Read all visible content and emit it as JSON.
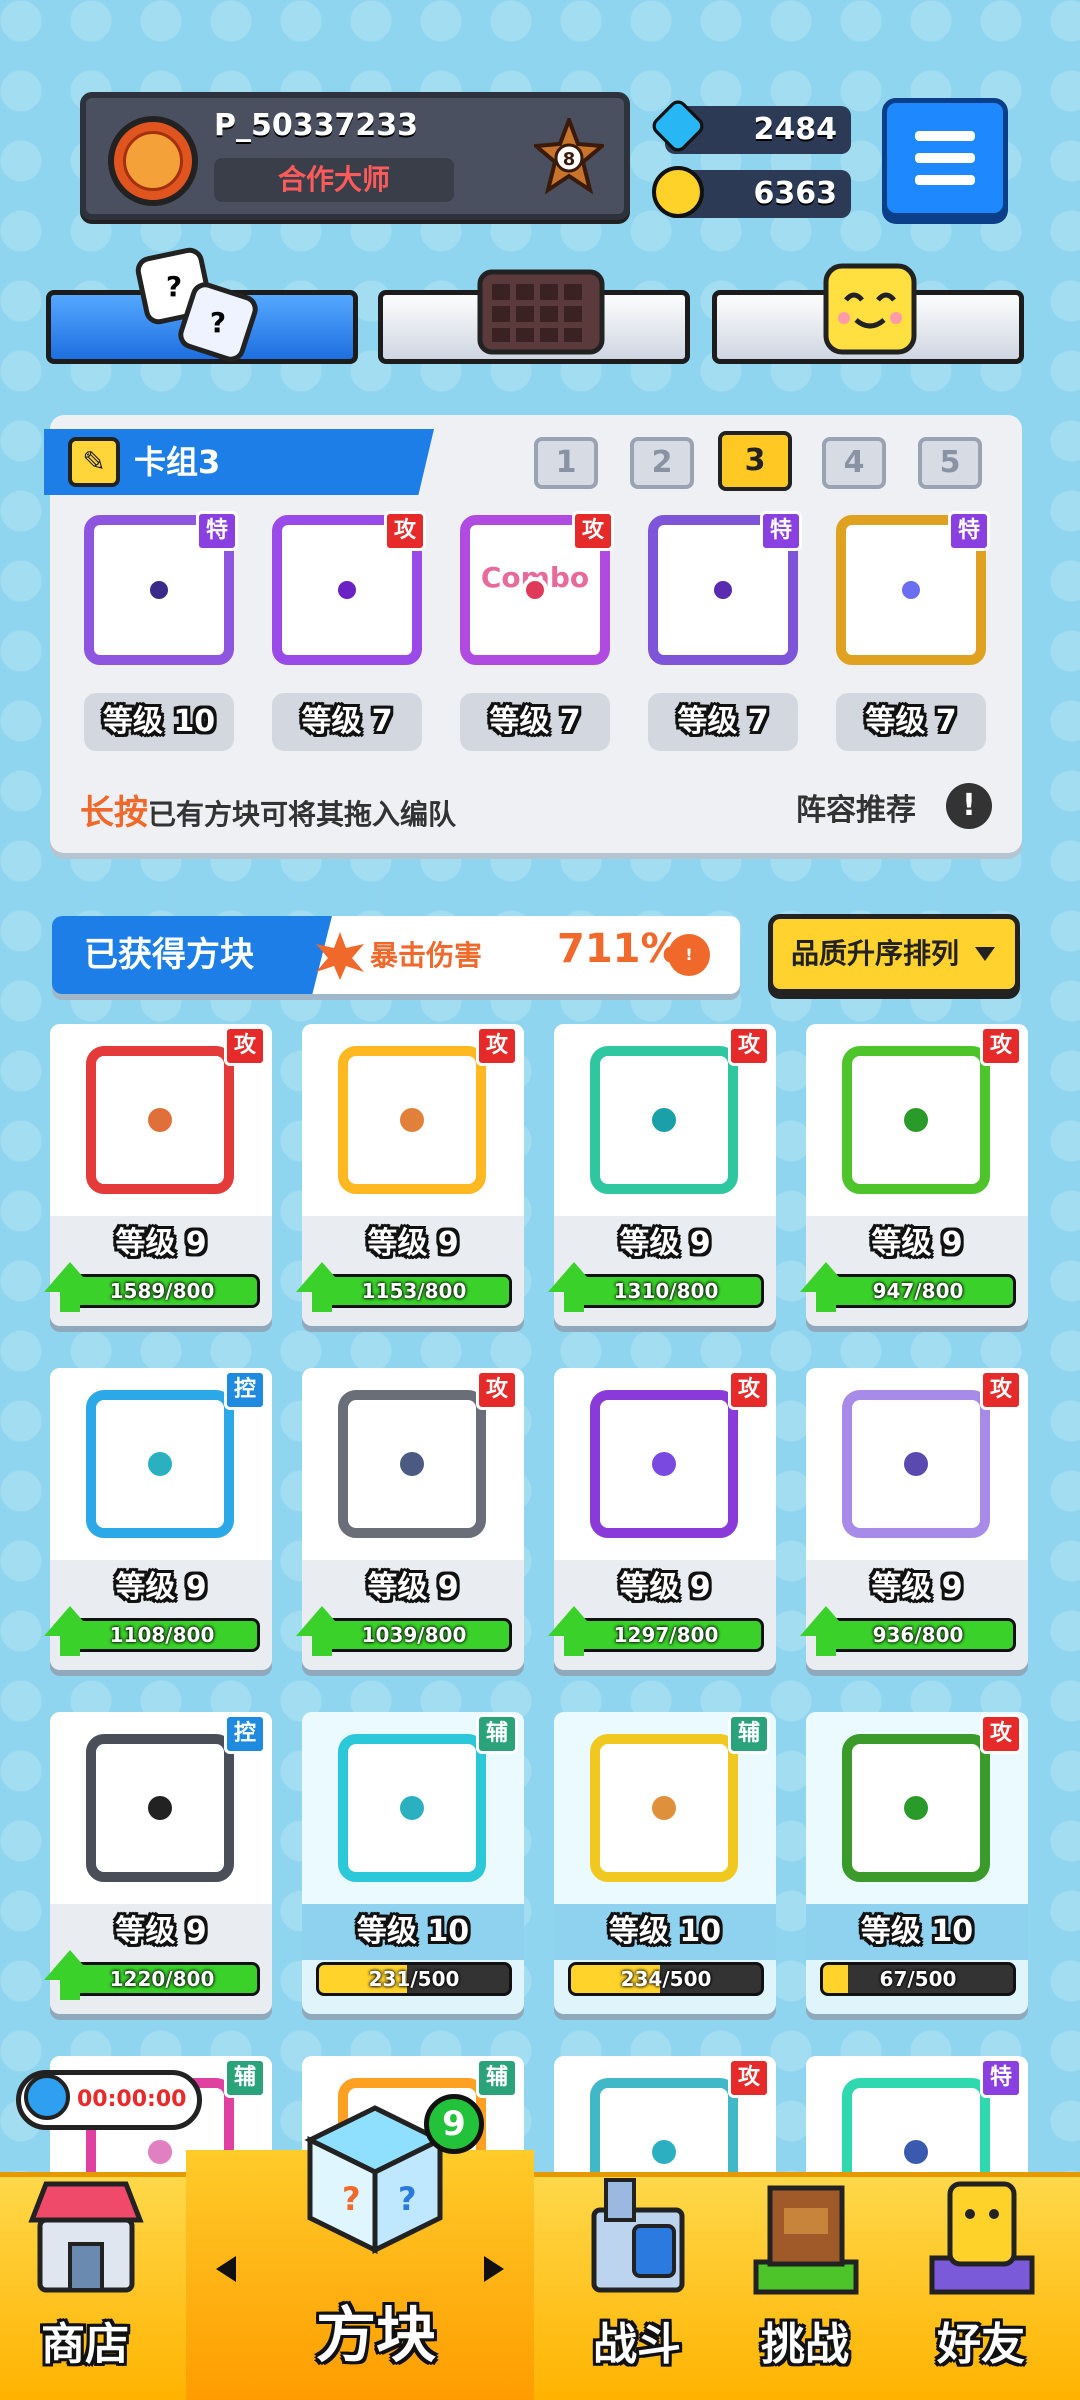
{
  "header": {
    "player_name": "P_50337233",
    "player_title": "合作大师",
    "rank_number": "8",
    "gems": "2484",
    "coins": "6363"
  },
  "colors": {
    "attack": "#e62a2a",
    "special": "#8a3fe0",
    "control": "#1e8ae0",
    "support": "#2aa37a",
    "accent_blue": "#1e7ee8"
  },
  "deck": {
    "title": "卡组3",
    "pages": [
      "1",
      "2",
      "3",
      "4",
      "5"
    ],
    "selected_page": "3",
    "cards": [
      {
        "badge": "特",
        "type": "special",
        "level": "等级 10",
        "color": "#8e55e0",
        "dot": "#3a2a8a",
        "icon": "cracked-block-icon"
      },
      {
        "badge": "攻",
        "type": "attack",
        "level": "等级 7",
        "color": "#9a4ae8",
        "dot": "#6b22c4",
        "icon": "magic-circle-block-icon"
      },
      {
        "badge": "攻",
        "type": "attack",
        "level": "等级 7",
        "color": "#b04ae0",
        "dot": "#e03a5a",
        "icon": "combo-block-icon",
        "text": "Combo"
      },
      {
        "badge": "特",
        "type": "special",
        "level": "等级 7",
        "color": "#7e55d8",
        "dot": "#5a2ab0",
        "icon": "arrows-block-icon"
      },
      {
        "badge": "特",
        "type": "special",
        "level": "等级 7",
        "color": "#e0a020",
        "dot": "#6b6ef0",
        "icon": "infinity-block-icon"
      }
    ],
    "hint_prefix": "长按",
    "hint_text": "已有方块可将其拖入编队",
    "lineup_label": "阵容推荐"
  },
  "owned": {
    "title": "已获得方块",
    "crit_label": "暴击伤害",
    "crit_value": "711%",
    "sort_label": "品质升序排列"
  },
  "blocks": [
    {
      "badge": "攻",
      "type": "attack",
      "level": "等级 9",
      "progress": "1589/800",
      "fill": 1.0,
      "color": "#e53a3a",
      "dot": "#e0703a",
      "icon": "fire-block-icon"
    },
    {
      "badge": "攻",
      "type": "attack",
      "level": "等级 9",
      "progress": "1153/800",
      "fill": 1.0,
      "color": "#ffb820",
      "dot": "#e0803a",
      "icon": "lightning-block-icon"
    },
    {
      "badge": "攻",
      "type": "attack",
      "level": "等级 9",
      "progress": "1310/800",
      "fill": 1.0,
      "color": "#2ec7a0",
      "dot": "#1aa0a8",
      "icon": "wind-block-icon"
    },
    {
      "badge": "攻",
      "type": "attack",
      "level": "等级 9",
      "progress": "947/800",
      "fill": 1.0,
      "color": "#4cc42a",
      "dot": "#2a9a2a",
      "icon": "poison-block-icon"
    },
    {
      "badge": "控",
      "type": "control",
      "level": "等级 9",
      "progress": "1108/800",
      "fill": 1.0,
      "color": "#2aa8e8",
      "dot": "#2ab0c0",
      "icon": "ice-block-icon"
    },
    {
      "badge": "攻",
      "type": "attack",
      "level": "等级 9",
      "progress": "1039/800",
      "fill": 1.0,
      "color": "#6a6e78",
      "dot": "#4a5a80",
      "icon": "gear-block-icon"
    },
    {
      "badge": "攻",
      "type": "attack",
      "level": "等级 9",
      "progress": "1297/800",
      "fill": 1.0,
      "color": "#8a3ad8",
      "dot": "#7a4ae0",
      "icon": "rotate-block-icon"
    },
    {
      "badge": "攻",
      "type": "attack",
      "level": "等级 9",
      "progress": "936/800",
      "fill": 1.0,
      "color": "#a88ae8",
      "dot": "#5a4ab0",
      "icon": "mystery-block-icon"
    },
    {
      "badge": "控",
      "type": "control",
      "level": "等级 9",
      "progress": "1220/800",
      "fill": 1.0,
      "color": "#4a4e58",
      "dot": "#222",
      "icon": "lock-block-icon"
    },
    {
      "badge": "辅",
      "type": "support",
      "level": "等级 10",
      "progress": "231/500",
      "fill": 0.462,
      "max": true,
      "color": "#2ac8d8",
      "dot": "#2ab0c0",
      "icon": "heal-block-icon"
    },
    {
      "badge": "辅",
      "type": "support",
      "level": "等级 10",
      "progress": "234/500",
      "fill": 0.468,
      "max": true,
      "color": "#f0c820",
      "dot": "#e0903a",
      "icon": "boost-block-icon"
    },
    {
      "badge": "攻",
      "type": "attack",
      "level": "等级 10",
      "progress": "67/500",
      "fill": 0.134,
      "max": true,
      "color": "#3a9a2a",
      "dot": "#2a9a2a",
      "icon": "thorn-block-icon"
    },
    {
      "badge": "辅",
      "type": "support",
      "level": "",
      "progress": "",
      "fill": 0,
      "color": "#e040a0",
      "dot": "#e080c0",
      "icon": "pink-block-icon"
    },
    {
      "badge": "辅",
      "type": "support",
      "level": "",
      "progress": "",
      "fill": 0,
      "color": "#ffa020",
      "dot": "#e0903a",
      "icon": "orange-block-icon"
    },
    {
      "badge": "攻",
      "type": "attack",
      "level": "",
      "progress": "",
      "fill": 0,
      "color": "#40b8c8",
      "dot": "#2ab0c0",
      "icon": "splash-block-icon"
    },
    {
      "badge": "特",
      "type": "special",
      "level": "",
      "progress": "",
      "fill": 0,
      "color": "#30d8b0",
      "dot": "#3a5ab0",
      "icon": "star-block-icon"
    }
  ],
  "timer": "00:00:00",
  "nav": {
    "shop": "商店",
    "blocks": "方块",
    "blocks_badge": "9",
    "battle": "战斗",
    "challenge": "挑战",
    "friends": "好友"
  }
}
